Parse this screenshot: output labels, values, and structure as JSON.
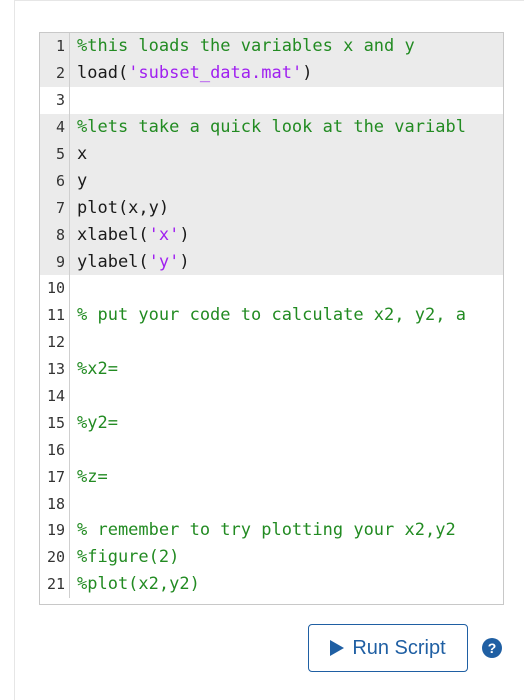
{
  "editor": {
    "lines": [
      {
        "num": "1",
        "highlight": true,
        "segments": [
          {
            "t": "%this loads the variables x and y",
            "c": "cmt"
          }
        ]
      },
      {
        "num": "2",
        "highlight": true,
        "segments": [
          {
            "t": "load(",
            "c": "plain"
          },
          {
            "t": "'subset_data.mat'",
            "c": "str"
          },
          {
            "t": ")",
            "c": "plain"
          }
        ]
      },
      {
        "num": "3",
        "highlight": false,
        "segments": []
      },
      {
        "num": "4",
        "highlight": true,
        "segments": [
          {
            "t": "%lets take a quick look at the variabl",
            "c": "cmt"
          }
        ]
      },
      {
        "num": "5",
        "highlight": true,
        "segments": [
          {
            "t": "x",
            "c": "plain"
          }
        ]
      },
      {
        "num": "6",
        "highlight": true,
        "segments": [
          {
            "t": "y",
            "c": "plain"
          }
        ]
      },
      {
        "num": "7",
        "highlight": true,
        "segments": [
          {
            "t": "plot(x,y)",
            "c": "plain"
          }
        ]
      },
      {
        "num": "8",
        "highlight": true,
        "segments": [
          {
            "t": "xlabel(",
            "c": "plain"
          },
          {
            "t": "'x'",
            "c": "str"
          },
          {
            "t": ")",
            "c": "plain"
          }
        ]
      },
      {
        "num": "9",
        "highlight": true,
        "segments": [
          {
            "t": "ylabel(",
            "c": "plain"
          },
          {
            "t": "'y'",
            "c": "str"
          },
          {
            "t": ")",
            "c": "plain"
          }
        ]
      },
      {
        "num": "10",
        "highlight": false,
        "segments": []
      },
      {
        "num": "11",
        "highlight": false,
        "segments": [
          {
            "t": "% put your code to calculate x2, y2, a",
            "c": "cmt"
          }
        ]
      },
      {
        "num": "12",
        "highlight": false,
        "segments": []
      },
      {
        "num": "13",
        "highlight": false,
        "segments": [
          {
            "t": "%x2=",
            "c": "cmt"
          }
        ]
      },
      {
        "num": "14",
        "highlight": false,
        "segments": []
      },
      {
        "num": "15",
        "highlight": false,
        "segments": [
          {
            "t": "%y2=",
            "c": "cmt"
          }
        ]
      },
      {
        "num": "16",
        "highlight": false,
        "segments": []
      },
      {
        "num": "17",
        "highlight": false,
        "segments": [
          {
            "t": "%z=",
            "c": "cmt"
          }
        ]
      },
      {
        "num": "18",
        "highlight": false,
        "segments": []
      },
      {
        "num": "19",
        "highlight": false,
        "segments": [
          {
            "t": "% remember to try plotting your x2,y2",
            "c": "cmt"
          }
        ]
      },
      {
        "num": "20",
        "highlight": false,
        "segments": [
          {
            "t": "%figure(2)",
            "c": "cmt"
          }
        ]
      },
      {
        "num": "21",
        "highlight": false,
        "segments": [
          {
            "t": "%plot(x2,y2)",
            "c": "cmt"
          }
        ]
      }
    ]
  },
  "toolbar": {
    "run_label": "Run Script",
    "help_glyph": "?",
    "play_icon": "play-icon",
    "help_icon": "help-icon"
  },
  "colors": {
    "comment": "#228b22",
    "string": "#a020f0",
    "accent": "#1f5fa3",
    "highlight": "#ebebeb"
  }
}
